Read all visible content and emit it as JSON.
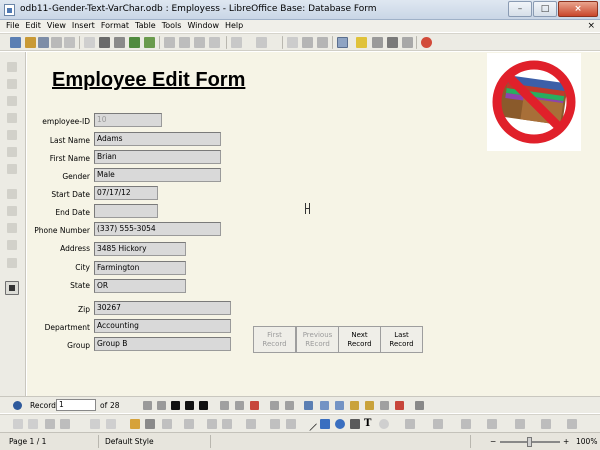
{
  "window": {
    "title": "odb11-Gender-Text-VarChar.odb : Employess - LibreOffice Base: Database Form",
    "buttons": {
      "minimize": "–",
      "maximize": "□",
      "close": "×"
    }
  },
  "menu": {
    "items": [
      "File",
      "Edit",
      "View",
      "Insert",
      "Format",
      "Table",
      "Tools",
      "Window",
      "Help"
    ],
    "close_glyph": "×"
  },
  "form": {
    "title": "Employee Edit Form",
    "fields": [
      {
        "label": "employee-ID",
        "value": "10",
        "disabled": true
      },
      {
        "label": "Last Name",
        "value": "Adams"
      },
      {
        "label": "First Name",
        "value": "Brian"
      },
      {
        "label": "Gender",
        "value": "Male"
      },
      {
        "label": "Start Date",
        "value": "07/17/12"
      },
      {
        "label": "End Date",
        "value": ""
      },
      {
        "label": "Phone Number",
        "value": "(337) 555-3054"
      },
      {
        "label": "Address",
        "value": "3485 Hickory"
      },
      {
        "label": "City",
        "value": "Farmington"
      },
      {
        "label": "State",
        "value": "OR"
      },
      {
        "label": "Zip",
        "value": "30267"
      },
      {
        "label": "Department",
        "value": "Accounting"
      },
      {
        "label": "Group",
        "value": "Group B"
      }
    ],
    "nav_buttons": [
      {
        "line1": "First",
        "line2": "Record",
        "disabled": true
      },
      {
        "line1": "Previous",
        "line2": "REcord",
        "disabled": true
      },
      {
        "line1": "Next",
        "line2": "Record",
        "disabled": false
      },
      {
        "line1": "Last",
        "line2": "Record",
        "disabled": false
      }
    ]
  },
  "record_bar": {
    "label": "Record",
    "current": "1",
    "of_label": "of",
    "total": "28"
  },
  "status": {
    "page": "Page 1 / 1",
    "style": "Default Style",
    "zoom": "100%",
    "zoom_minus": "−",
    "zoom_plus": "+"
  },
  "colors": {
    "form_bg": "#f6f4e6",
    "field_bg": "#d9d9d9",
    "logo_red": "#e0202a"
  }
}
